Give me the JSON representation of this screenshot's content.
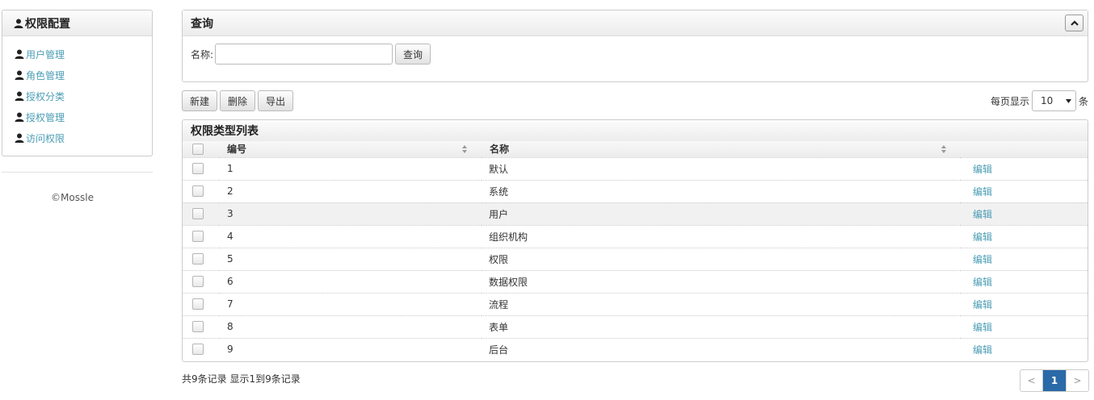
{
  "sidebar": {
    "title": "权限配置",
    "items": [
      {
        "label": "用户管理"
      },
      {
        "label": "角色管理"
      },
      {
        "label": "授权分类"
      },
      {
        "label": "授权管理"
      },
      {
        "label": "访问权限"
      }
    ],
    "copyright": "©Mossle"
  },
  "query": {
    "title": "查询",
    "name_label": "名称:",
    "name_value": "",
    "submit_label": "查询"
  },
  "toolbar": {
    "new_label": "新建",
    "delete_label": "删除",
    "export_label": "导出",
    "page_size_prefix": "每页显示",
    "page_size_value": "10",
    "page_size_suffix": "条"
  },
  "table": {
    "title": "权限类型列表",
    "columns": [
      "编号",
      "名称"
    ],
    "edit_label": "编辑",
    "rows": [
      {
        "id": "1",
        "name": "默认"
      },
      {
        "id": "2",
        "name": "系统"
      },
      {
        "id": "3",
        "name": "用户"
      },
      {
        "id": "4",
        "name": "组织机构"
      },
      {
        "id": "5",
        "name": "权限"
      },
      {
        "id": "6",
        "name": "数据权限"
      },
      {
        "id": "7",
        "name": "流程"
      },
      {
        "id": "8",
        "name": "表单"
      },
      {
        "id": "9",
        "name": "后台"
      }
    ]
  },
  "footer": {
    "records_info": "共9条记录 显示1到9条记录",
    "pager": {
      "prev": "<",
      "current": "1",
      "next": ">"
    }
  },
  "colors": {
    "link": "#4a9db5",
    "pager_active": "#2a6aa8"
  }
}
